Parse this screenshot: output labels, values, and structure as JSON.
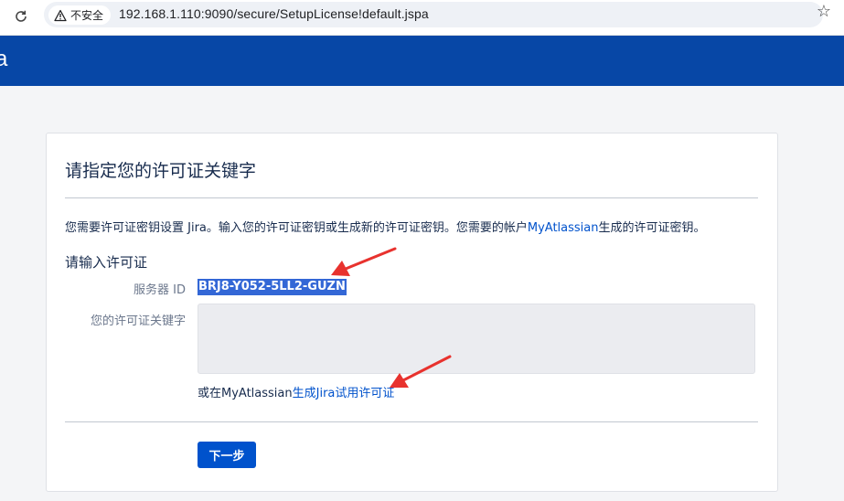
{
  "browser": {
    "security_label": "不安全",
    "url": "192.168.1.110:9090/secure/SetupLicense!default.jspa",
    "icons": [
      "reload-icon",
      "warning-icon",
      "star-icon"
    ]
  },
  "app_header": {
    "logo_fragment": "a",
    "color": "#0747a6"
  },
  "page": {
    "title": "请指定您的许可证关键字",
    "description_before": "您需要许可证密钥设置 Jira。输入您的许可证密钥或生成新的许可证密钥。您需要的帐户",
    "description_link": "MyAtlassian",
    "description_after": "生成的许可证密钥。",
    "section_heading": "请输入许可证",
    "server_id_label": "服务器 ID",
    "server_id_value": "BRJ8-Y052-5LL2-GUZN",
    "license_key_label": "您的许可证关键字",
    "license_key_value": "",
    "alt_before": "或在MyAtlassian",
    "alt_link": "生成Jira试用许可证",
    "next_button": "下一步"
  },
  "colors": {
    "link": "#0052cc",
    "button": "#0052cc",
    "annotation_arrow": "#e8322e"
  }
}
